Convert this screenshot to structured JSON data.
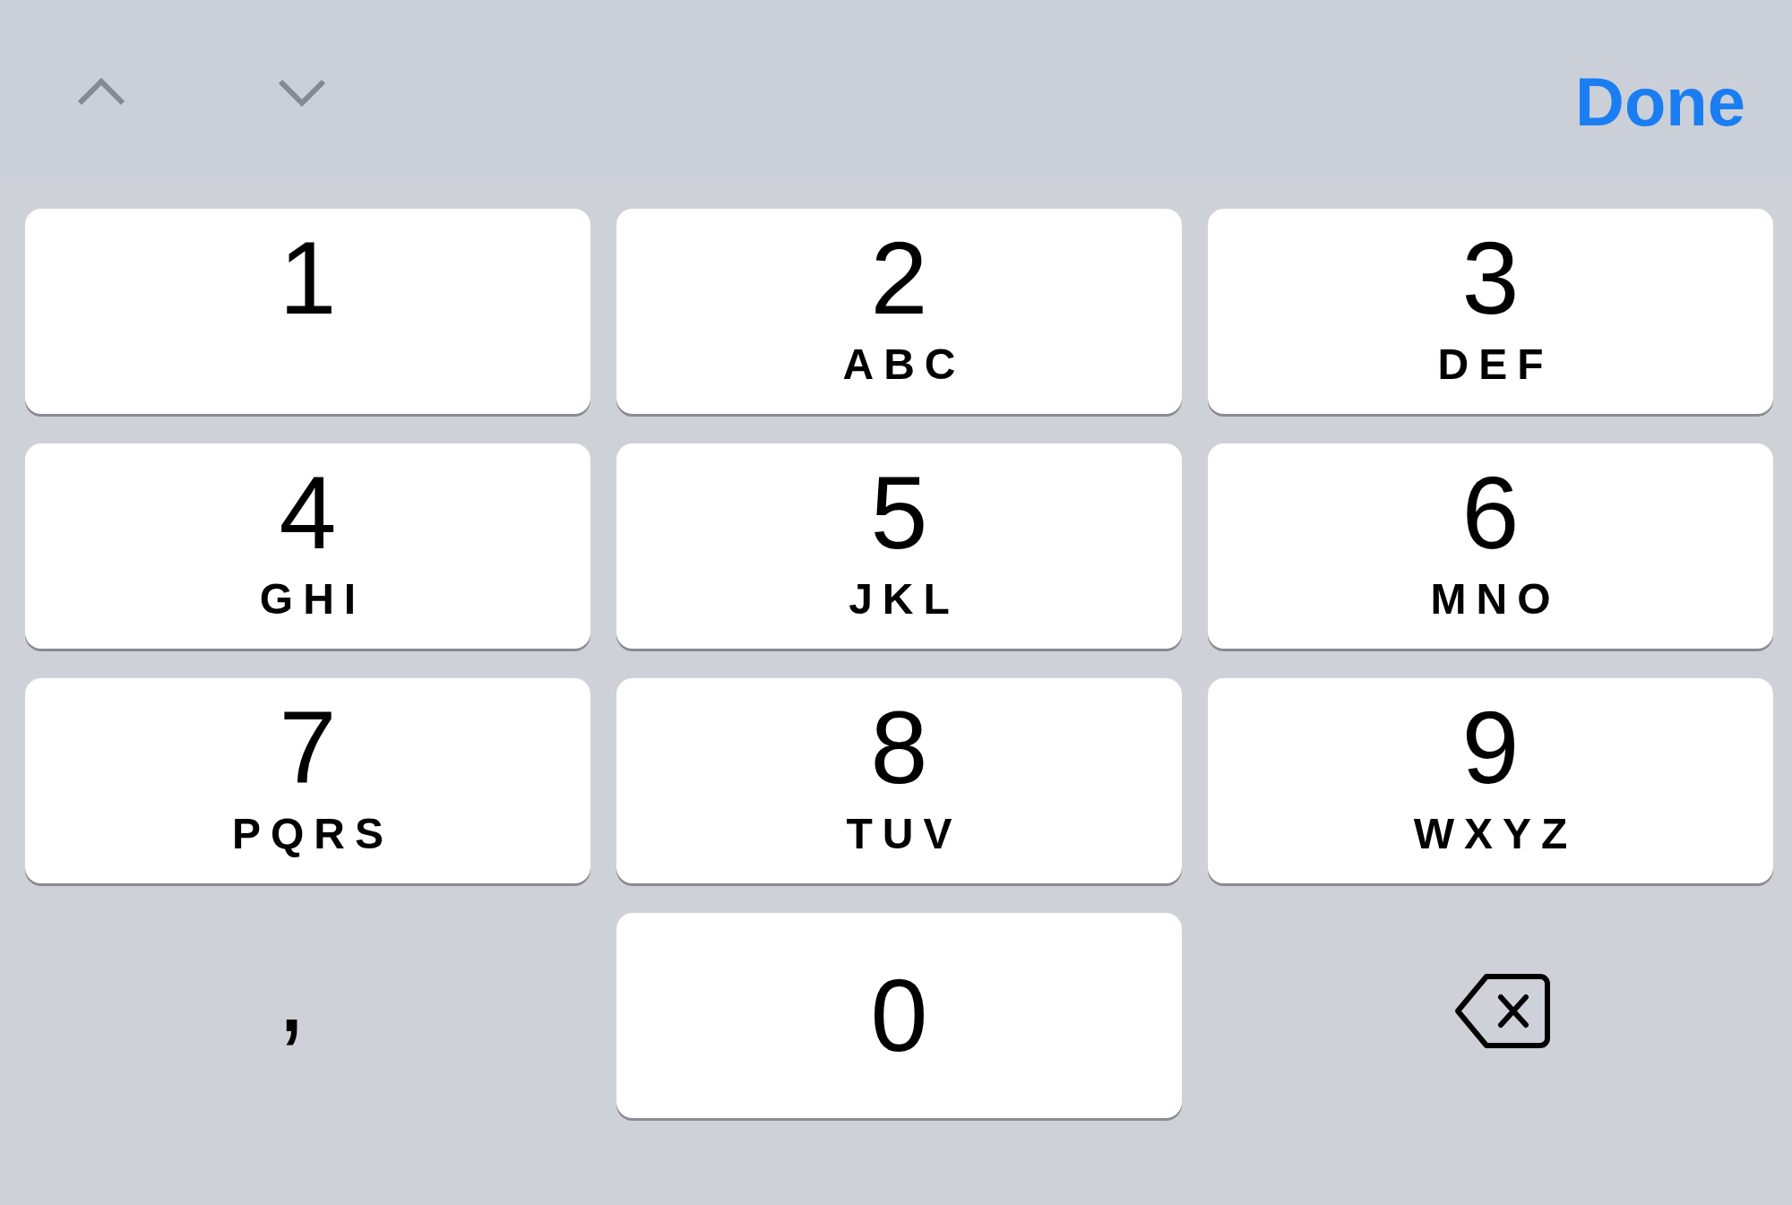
{
  "toolbar": {
    "done": "Done"
  },
  "rows": [
    {
      "keys": [
        {
          "kind": "digit",
          "digit": "1"
        },
        {
          "kind": "digit",
          "digit": "2",
          "letters": "ABC"
        },
        {
          "kind": "digit",
          "digit": "3",
          "letters": "DEF"
        }
      ]
    },
    {
      "keys": [
        {
          "kind": "digit",
          "digit": "4",
          "letters": "GHI"
        },
        {
          "kind": "digit",
          "digit": "5",
          "letters": "JKL"
        },
        {
          "kind": "digit",
          "digit": "6",
          "letters": "MNO"
        }
      ]
    },
    {
      "keys": [
        {
          "kind": "digit",
          "digit": "7",
          "letters": "PQRS"
        },
        {
          "kind": "digit",
          "digit": "8",
          "letters": "TUV"
        },
        {
          "kind": "digit",
          "digit": "9",
          "letters": "WXYZ"
        }
      ]
    },
    {
      "keys": [
        {
          "kind": "symbol",
          "label": ","
        },
        {
          "kind": "plain",
          "label": "0"
        },
        {
          "kind": "delete"
        }
      ]
    }
  ]
}
